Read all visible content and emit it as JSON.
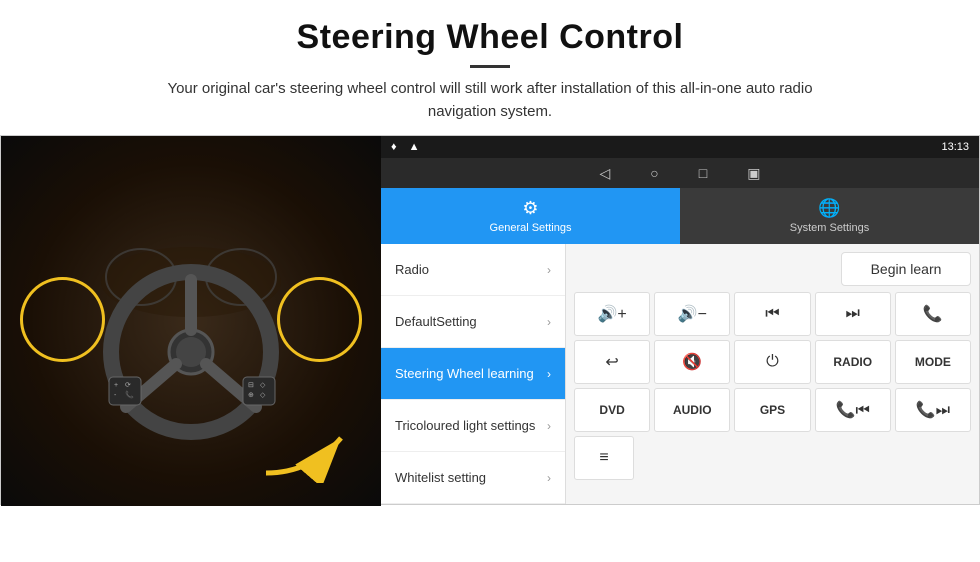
{
  "header": {
    "title": "Steering Wheel Control",
    "subtitle": "Your original car's steering wheel control will still work after installation of this all-in-one auto radio navigation system."
  },
  "statusBar": {
    "navIcons": [
      "◁",
      "○",
      "□",
      "▣"
    ],
    "time": "13:13",
    "signalIcons": "♦ ▲"
  },
  "tabs": {
    "general": "General Settings",
    "system": "System Settings"
  },
  "menu": {
    "items": [
      {
        "label": "Radio",
        "active": false
      },
      {
        "label": "DefaultSetting",
        "active": false
      },
      {
        "label": "Steering Wheel learning",
        "active": true
      },
      {
        "label": "Tricoloured light settings",
        "active": false
      },
      {
        "label": "Whitelist setting",
        "active": false
      }
    ]
  },
  "controls": {
    "beginLearn": "Begin learn",
    "row1": [
      {
        "icon": "🔊+",
        "label": "vol_up"
      },
      {
        "icon": "🔊-",
        "label": "vol_down"
      },
      {
        "icon": "⏮",
        "label": "prev"
      },
      {
        "icon": "⏭",
        "label": "next"
      },
      {
        "icon": "📞",
        "label": "call"
      }
    ],
    "row2": [
      {
        "icon": "↩",
        "label": "hangup"
      },
      {
        "icon": "🔇",
        "label": "mute"
      },
      {
        "icon": "⏻",
        "label": "power"
      },
      {
        "text": "RADIO",
        "label": "radio_btn"
      },
      {
        "text": "MODE",
        "label": "mode_btn"
      }
    ],
    "row3": [
      {
        "text": "DVD",
        "label": "dvd_btn"
      },
      {
        "text": "AUDIO",
        "label": "audio_btn"
      },
      {
        "text": "GPS",
        "label": "gps_btn"
      },
      {
        "icon": "📞⏮",
        "label": "call_prev"
      },
      {
        "icon": "📞⏭",
        "label": "call_next"
      }
    ],
    "row4_icon": "≡"
  }
}
